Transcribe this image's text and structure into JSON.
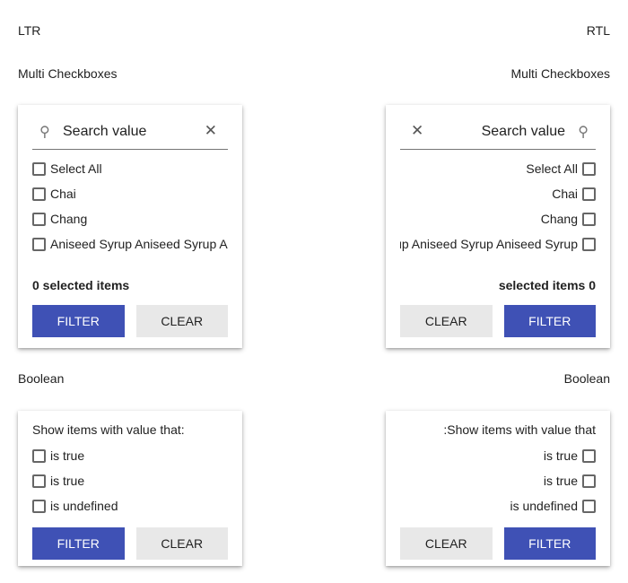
{
  "headers": {
    "ltr": "LTR",
    "rtl": "RTL"
  },
  "sections": {
    "multi": "Multi Checkboxes",
    "boolean": "Boolean"
  },
  "multi": {
    "search_placeholder": "Search value",
    "items": [
      "Select All",
      "Chai",
      "Chang",
      "Aniseed Syrup Aniseed Syrup Aniseed Syrup"
    ],
    "count_ltr": "0 selected items",
    "count_rtl": "selected items 0"
  },
  "boolean": {
    "prompt_ltr": "Show items with value that:",
    "prompt_rtl": ":Show items with value that",
    "items": [
      "is true",
      "is true",
      "is undefined"
    ]
  },
  "buttons": {
    "filter": "FILTER",
    "clear": "CLEAR"
  },
  "colors": {
    "primary": "#3f51b5",
    "secondary": "#e8e8e8"
  }
}
